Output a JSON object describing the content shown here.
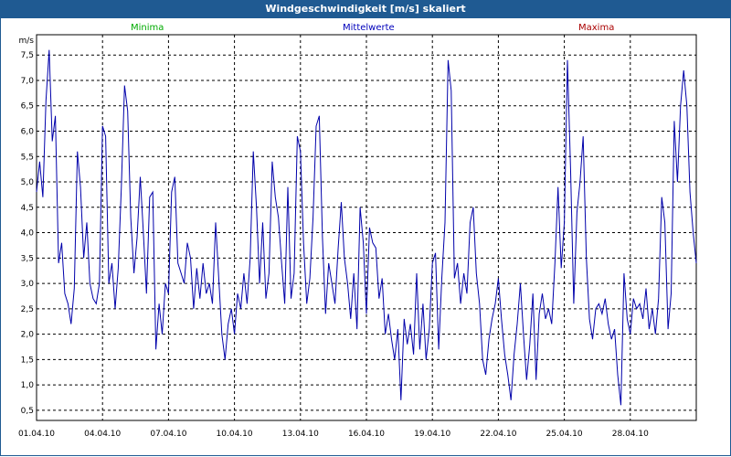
{
  "window": {
    "title": "Windgeschwindigkeit [m/s] skaliert"
  },
  "legend": {
    "minima": "Minima",
    "mittelwerte": "Mittelwerte",
    "maxima": "Maxima"
  },
  "colors": {
    "title_bg": "#1f5a92",
    "minima": "#00aa00",
    "mittelwerte": "#0000bb",
    "maxima": "#aa0000",
    "series": "#0000aa",
    "grid": "#000000"
  },
  "chart_data": {
    "type": "line",
    "ylabel": "m/s",
    "ylim": [
      0.3,
      7.9
    ],
    "y_ticks": [
      "0,5",
      "1,0",
      "1,5",
      "2,0",
      "2,5",
      "3,0",
      "3,5",
      "4,0",
      "4,5",
      "5,0",
      "5,5",
      "6,0",
      "6,5",
      "7,0",
      "7,5"
    ],
    "y_tick_values": [
      0.5,
      1.0,
      1.5,
      2.0,
      2.5,
      3.0,
      3.5,
      4.0,
      4.5,
      5.0,
      5.5,
      6.0,
      6.5,
      7.0,
      7.5
    ],
    "x_ticks": [
      "01.04.10",
      "04.04.10",
      "07.04.10",
      "10.04.10",
      "13.04.10",
      "16.04.10",
      "19.04.10",
      "22.04.10",
      "25.04.10",
      "28.04.10"
    ],
    "xlim": [
      "01.04.10",
      "01.05.10"
    ],
    "grid": true,
    "series": [
      {
        "name": "Mittelwerte",
        "points": [
          [
            0.0,
            4.8
          ],
          [
            0.2,
            5.4
          ],
          [
            0.4,
            4.7
          ],
          [
            0.6,
            6.6
          ],
          [
            0.8,
            7.6
          ],
          [
            1.0,
            5.8
          ],
          [
            1.2,
            6.3
          ],
          [
            1.4,
            3.4
          ],
          [
            1.6,
            3.8
          ],
          [
            1.8,
            2.8
          ],
          [
            2.0,
            2.6
          ],
          [
            2.2,
            2.2
          ],
          [
            2.4,
            2.9
          ],
          [
            2.6,
            5.6
          ],
          [
            2.8,
            4.9
          ],
          [
            3.0,
            3.5
          ],
          [
            3.2,
            4.2
          ],
          [
            3.4,
            3.0
          ],
          [
            3.6,
            2.7
          ],
          [
            3.8,
            2.6
          ],
          [
            4.0,
            3.0
          ],
          [
            4.2,
            6.1
          ],
          [
            4.4,
            5.9
          ],
          [
            4.6,
            3.0
          ],
          [
            4.8,
            3.4
          ],
          [
            5.0,
            2.5
          ],
          [
            5.2,
            3.3
          ],
          [
            5.4,
            4.9
          ],
          [
            5.6,
            6.9
          ],
          [
            5.8,
            6.4
          ],
          [
            6.0,
            4.3
          ],
          [
            6.2,
            3.2
          ],
          [
            6.4,
            3.9
          ],
          [
            6.6,
            5.1
          ],
          [
            6.8,
            4.0
          ],
          [
            7.0,
            2.8
          ],
          [
            7.2,
            4.7
          ],
          [
            7.4,
            4.8
          ],
          [
            7.6,
            1.7
          ],
          [
            7.8,
            2.6
          ],
          [
            8.0,
            2.0
          ],
          [
            8.2,
            3.0
          ],
          [
            8.4,
            2.8
          ],
          [
            8.6,
            4.8
          ],
          [
            8.8,
            5.1
          ],
          [
            9.0,
            3.4
          ],
          [
            9.2,
            3.2
          ],
          [
            9.4,
            3.0
          ],
          [
            9.6,
            3.8
          ],
          [
            9.8,
            3.5
          ],
          [
            10.0,
            2.5
          ],
          [
            10.2,
            3.3
          ],
          [
            10.4,
            2.7
          ],
          [
            10.6,
            3.4
          ],
          [
            10.8,
            2.8
          ],
          [
            11.0,
            3.0
          ],
          [
            11.2,
            2.6
          ],
          [
            11.4,
            4.2
          ],
          [
            11.6,
            3.1
          ],
          [
            11.8,
            2.0
          ],
          [
            12.0,
            1.5
          ],
          [
            12.2,
            2.2
          ],
          [
            12.4,
            2.5
          ],
          [
            12.6,
            2.0
          ],
          [
            12.8,
            2.8
          ],
          [
            13.0,
            2.5
          ],
          [
            13.2,
            3.2
          ],
          [
            13.4,
            2.6
          ],
          [
            13.6,
            3.5
          ],
          [
            13.8,
            5.6
          ],
          [
            14.0,
            4.5
          ],
          [
            14.2,
            3.0
          ],
          [
            14.4,
            4.2
          ],
          [
            14.6,
            2.7
          ],
          [
            14.8,
            3.2
          ],
          [
            15.0,
            5.4
          ],
          [
            15.2,
            4.7
          ],
          [
            15.4,
            4.3
          ],
          [
            15.6,
            3.4
          ],
          [
            15.8,
            2.6
          ],
          [
            16.0,
            4.9
          ],
          [
            16.2,
            2.7
          ],
          [
            16.4,
            3.2
          ],
          [
            16.6,
            5.9
          ],
          [
            16.8,
            5.6
          ],
          [
            17.0,
            3.8
          ],
          [
            17.2,
            2.6
          ],
          [
            17.4,
            3.1
          ],
          [
            17.6,
            4.3
          ],
          [
            17.8,
            6.1
          ],
          [
            18.0,
            6.3
          ],
          [
            18.2,
            3.9
          ],
          [
            18.4,
            2.4
          ],
          [
            18.6,
            3.4
          ],
          [
            18.8,
            3.0
          ],
          [
            19.0,
            2.6
          ],
          [
            19.2,
            3.7
          ],
          [
            19.4,
            4.6
          ],
          [
            19.6,
            3.5
          ],
          [
            19.8,
            3.0
          ],
          [
            20.0,
            2.3
          ],
          [
            20.2,
            3.2
          ],
          [
            20.4,
            2.1
          ],
          [
            20.6,
            4.5
          ],
          [
            20.8,
            3.8
          ],
          [
            21.0,
            2.4
          ],
          [
            21.2,
            4.1
          ],
          [
            21.4,
            3.8
          ],
          [
            21.6,
            3.7
          ],
          [
            21.8,
            2.7
          ],
          [
            22.0,
            3.1
          ],
          [
            22.2,
            2.0
          ],
          [
            22.4,
            2.4
          ],
          [
            22.6,
            1.9
          ],
          [
            22.8,
            1.5
          ],
          [
            23.0,
            2.1
          ],
          [
            23.2,
            0.7
          ],
          [
            23.4,
            2.3
          ],
          [
            23.6,
            1.8
          ],
          [
            23.8,
            2.2
          ],
          [
            24.0,
            1.6
          ],
          [
            24.2,
            3.2
          ],
          [
            24.4,
            1.7
          ],
          [
            24.6,
            2.6
          ],
          [
            24.8,
            1.5
          ],
          [
            25.0,
            2.1
          ],
          [
            25.2,
            3.4
          ],
          [
            25.4,
            3.6
          ],
          [
            25.6,
            1.7
          ],
          [
            25.8,
            3.1
          ],
          [
            26.0,
            4.2
          ],
          [
            26.2,
            7.4
          ],
          [
            26.4,
            6.8
          ],
          [
            26.6,
            3.1
          ],
          [
            26.8,
            3.4
          ],
          [
            27.0,
            2.6
          ],
          [
            27.2,
            3.2
          ],
          [
            27.4,
            2.8
          ],
          [
            27.6,
            4.2
          ],
          [
            27.8,
            4.5
          ],
          [
            28.0,
            3.2
          ],
          [
            28.2,
            2.6
          ],
          [
            28.4,
            1.5
          ],
          [
            28.6,
            1.2
          ],
          [
            28.8,
            1.9
          ],
          [
            29.0,
            2.3
          ],
          [
            29.2,
            2.6
          ],
          [
            29.4,
            3.1
          ],
          [
            29.6,
            2.3
          ],
          [
            29.8,
            1.6
          ],
          [
            30.0,
            1.2
          ],
          [
            30.2,
            0.7
          ],
          [
            30.4,
            1.6
          ],
          [
            30.6,
            2.2
          ],
          [
            30.8,
            3.0
          ],
          [
            31.0,
            2.0
          ],
          [
            31.2,
            1.1
          ],
          [
            31.4,
            1.8
          ],
          [
            31.6,
            2.8
          ],
          [
            31.8,
            1.1
          ],
          [
            32.0,
            2.4
          ],
          [
            32.2,
            2.8
          ],
          [
            32.4,
            2.3
          ],
          [
            32.6,
            2.5
          ],
          [
            32.8,
            2.2
          ],
          [
            33.0,
            3.4
          ],
          [
            33.2,
            4.9
          ],
          [
            33.4,
            3.3
          ],
          [
            33.6,
            4.2
          ],
          [
            33.8,
            7.4
          ],
          [
            34.0,
            5.2
          ],
          [
            34.2,
            2.6
          ],
          [
            34.4,
            4.4
          ],
          [
            34.6,
            5.0
          ],
          [
            34.8,
            5.9
          ],
          [
            35.0,
            3.5
          ],
          [
            35.2,
            2.3
          ],
          [
            35.4,
            1.9
          ],
          [
            35.6,
            2.5
          ],
          [
            35.8,
            2.6
          ],
          [
            36.0,
            2.4
          ],
          [
            36.2,
            2.7
          ],
          [
            36.4,
            2.2
          ],
          [
            36.6,
            1.9
          ],
          [
            36.8,
            2.1
          ],
          [
            37.0,
            1.2
          ],
          [
            37.2,
            0.6
          ],
          [
            37.4,
            3.2
          ],
          [
            37.6,
            2.3
          ],
          [
            37.8,
            2.0
          ],
          [
            38.0,
            2.7
          ],
          [
            38.2,
            2.5
          ],
          [
            38.4,
            2.6
          ],
          [
            38.6,
            2.3
          ],
          [
            38.8,
            2.9
          ],
          [
            39.0,
            2.1
          ],
          [
            39.2,
            2.5
          ],
          [
            39.4,
            2.0
          ],
          [
            39.6,
            2.7
          ],
          [
            39.8,
            4.7
          ],
          [
            40.0,
            4.2
          ],
          [
            40.2,
            2.1
          ],
          [
            40.4,
            2.8
          ],
          [
            40.6,
            6.2
          ],
          [
            40.8,
            5.0
          ],
          [
            41.0,
            6.5
          ],
          [
            41.2,
            7.2
          ],
          [
            41.4,
            6.5
          ],
          [
            41.6,
            4.8
          ],
          [
            41.8,
            4.0
          ],
          [
            42.0,
            3.4
          ]
        ]
      }
    ]
  }
}
